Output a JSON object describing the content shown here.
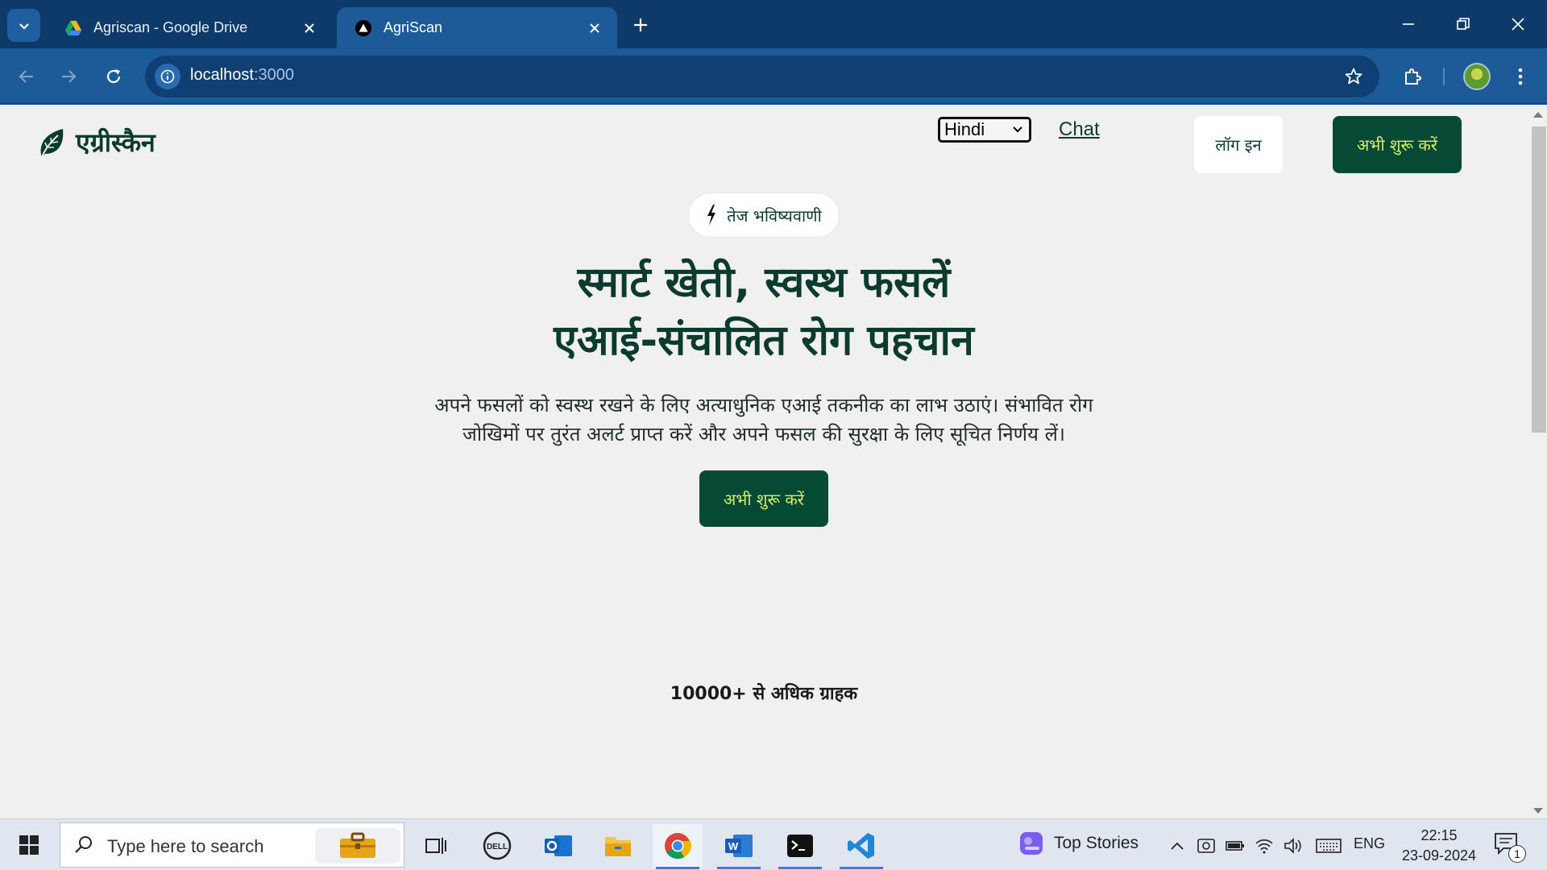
{
  "browser": {
    "tabs": [
      {
        "title": "Agriscan - Google Drive",
        "favicon": "google-drive-icon",
        "active": false
      },
      {
        "title": "AgriScan",
        "favicon": "vercel-triangle-icon",
        "active": true
      }
    ],
    "url_host": "localhost",
    "url_port": ":3000"
  },
  "site": {
    "logo_text": "एग्रीस्कैन",
    "language_selected": "Hindi",
    "nav_chat": "Chat",
    "login_label": "लॉग इन",
    "start_label": "अभी शुरू करें",
    "badge_text": "तेज भविष्यवाणी",
    "hero_line1": "स्मार्ट खेती, स्वस्थ फसलें",
    "hero_line2": "एआई-संचालित रोग पहचान",
    "hero_sub_line1": "अपने फसलों को स्वस्थ रखने के लिए अत्याधुनिक एआई तकनीक का लाभ उठाएं। संभावित रोग",
    "hero_sub_line2": "जोखिमों पर तुरंत अलर्ट प्राप्त करें और अपने फसल की सुरक्षा के लिए सूचित निर्णय लें।",
    "hero_cta": "अभी शुरू करें",
    "customers_text": "10000+ से अधिक ग्राहक",
    "colors": {
      "brand_dark": "#064a36",
      "brand_text": "#0b3b2e",
      "cta_text": "#d6ef6a",
      "page_bg": "#f0f0ef"
    }
  },
  "taskbar": {
    "search_placeholder": "Type here to search",
    "news_label": "Top Stories",
    "language": "ENG",
    "time": "22:15",
    "date": "23-09-2024",
    "notification_count": "1"
  }
}
